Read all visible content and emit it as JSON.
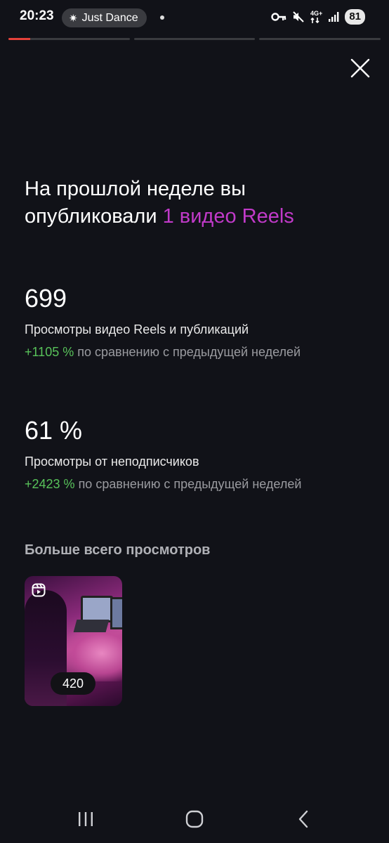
{
  "status_bar": {
    "time": "20:23",
    "media_label": "Just Dance",
    "network_label": "4G+",
    "battery": "81"
  },
  "story": {
    "segments": 3,
    "active_progress": 0.18,
    "accent_color": "#e4413a"
  },
  "headline": {
    "text": "На прошлой неделе вы опубликовали ",
    "highlight": "1 видео Reels",
    "highlight_color": "#c13ac9"
  },
  "stats": [
    {
      "value": "699",
      "label": "Просмотры видео Reels и публикаций",
      "delta": "+1105 %",
      "compare": " по сравнению с предыдущей неделей"
    },
    {
      "value": "61 %",
      "label": "Просмотры от неподписчиков",
      "delta": "+2423 %",
      "compare": " по сравнению с предыдущей неделей"
    }
  ],
  "top_section": {
    "title": "Больше всего просмотров",
    "items": [
      {
        "views": "420",
        "icon": "reels-icon"
      }
    ]
  },
  "colors": {
    "background": "#111218",
    "positive": "#58c25a",
    "muted": "#9a9ba0"
  },
  "icons": {
    "close": "close-icon",
    "nav_recents": "recents-icon",
    "nav_home": "home-icon",
    "nav_back": "back-icon"
  }
}
